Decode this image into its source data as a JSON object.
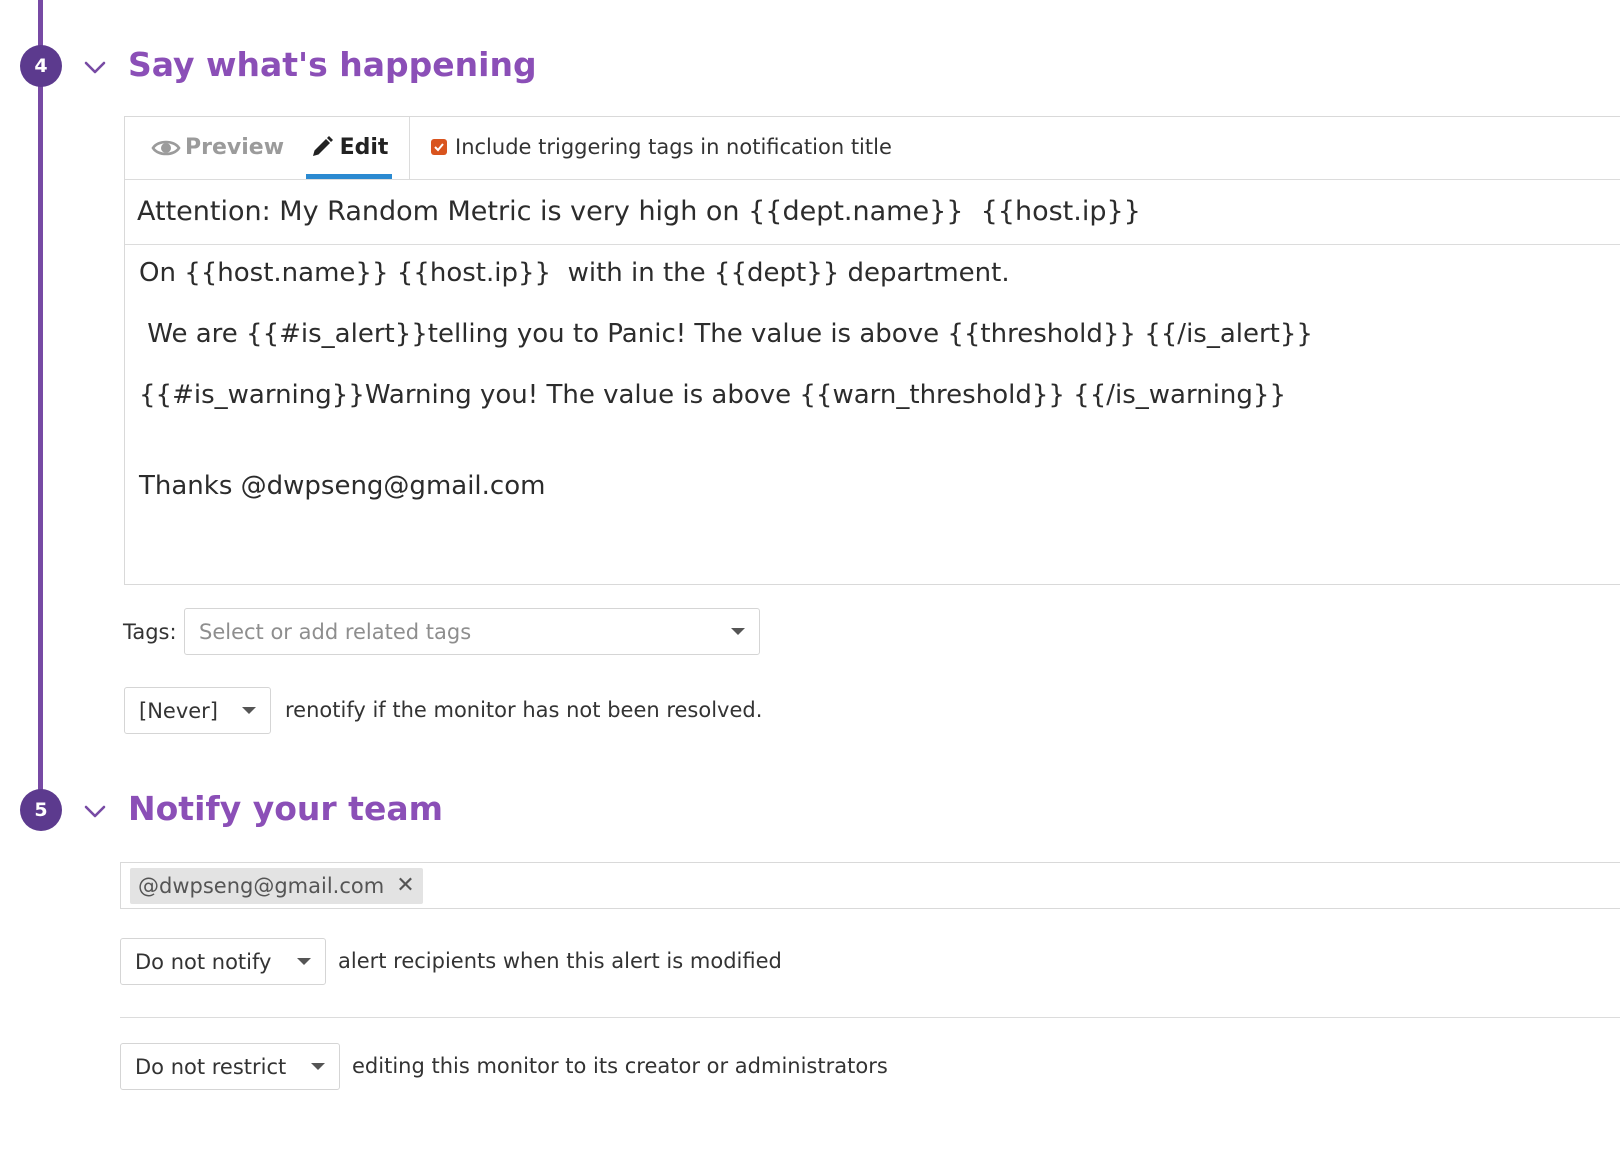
{
  "section4": {
    "step": "4",
    "title": "Say what's happening",
    "editor": {
      "tab_preview": "Preview",
      "tab_edit": "Edit",
      "include_tags_label": "Include triggering tags in notification title",
      "include_tags_checked": true,
      "title_value": "Attention: My Random Metric is very high on {{dept.name}}  {{host.ip}}",
      "body_lines": [
        "On {{host.name}} {{host.ip}}  with in the {{dept}} department.",
        " We are {{#is_alert}}telling you to Panic! The value is above {{threshold}} {{/is_alert}}",
        "{{#is_warning}}Warning you! The value is above {{warn_threshold}} {{/is_warning}}",
        "",
        "Thanks @dwpseng@gmail.com"
      ]
    },
    "tags_label": "Tags:",
    "tags_placeholder": "Select or add related tags",
    "renotify_value": "[Never]",
    "renotify_text": "renotify if the monitor has not been resolved."
  },
  "section5": {
    "step": "5",
    "title": "Notify your team",
    "recipients": [
      "@dwpseng@gmail.com"
    ],
    "notify_modified_value": "Do not notify",
    "notify_modified_text": "alert recipients when this alert is modified",
    "restrict_value": "Do not restrict",
    "restrict_text": "editing this monitor to its creator or administrators"
  },
  "colors": {
    "accent_purple": "#8b4fb7",
    "timeline_purple": "#774aa4",
    "badge_purple": "#5c3a8e",
    "tab_underline_blue": "#2b8ad1",
    "checkbox_orange": "#d9541e"
  },
  "icons": {
    "preview": "eye-icon",
    "edit": "pencil-icon",
    "collapse": "chevron-down-icon",
    "dropdown": "caret-down-icon",
    "remove": "close-icon"
  }
}
